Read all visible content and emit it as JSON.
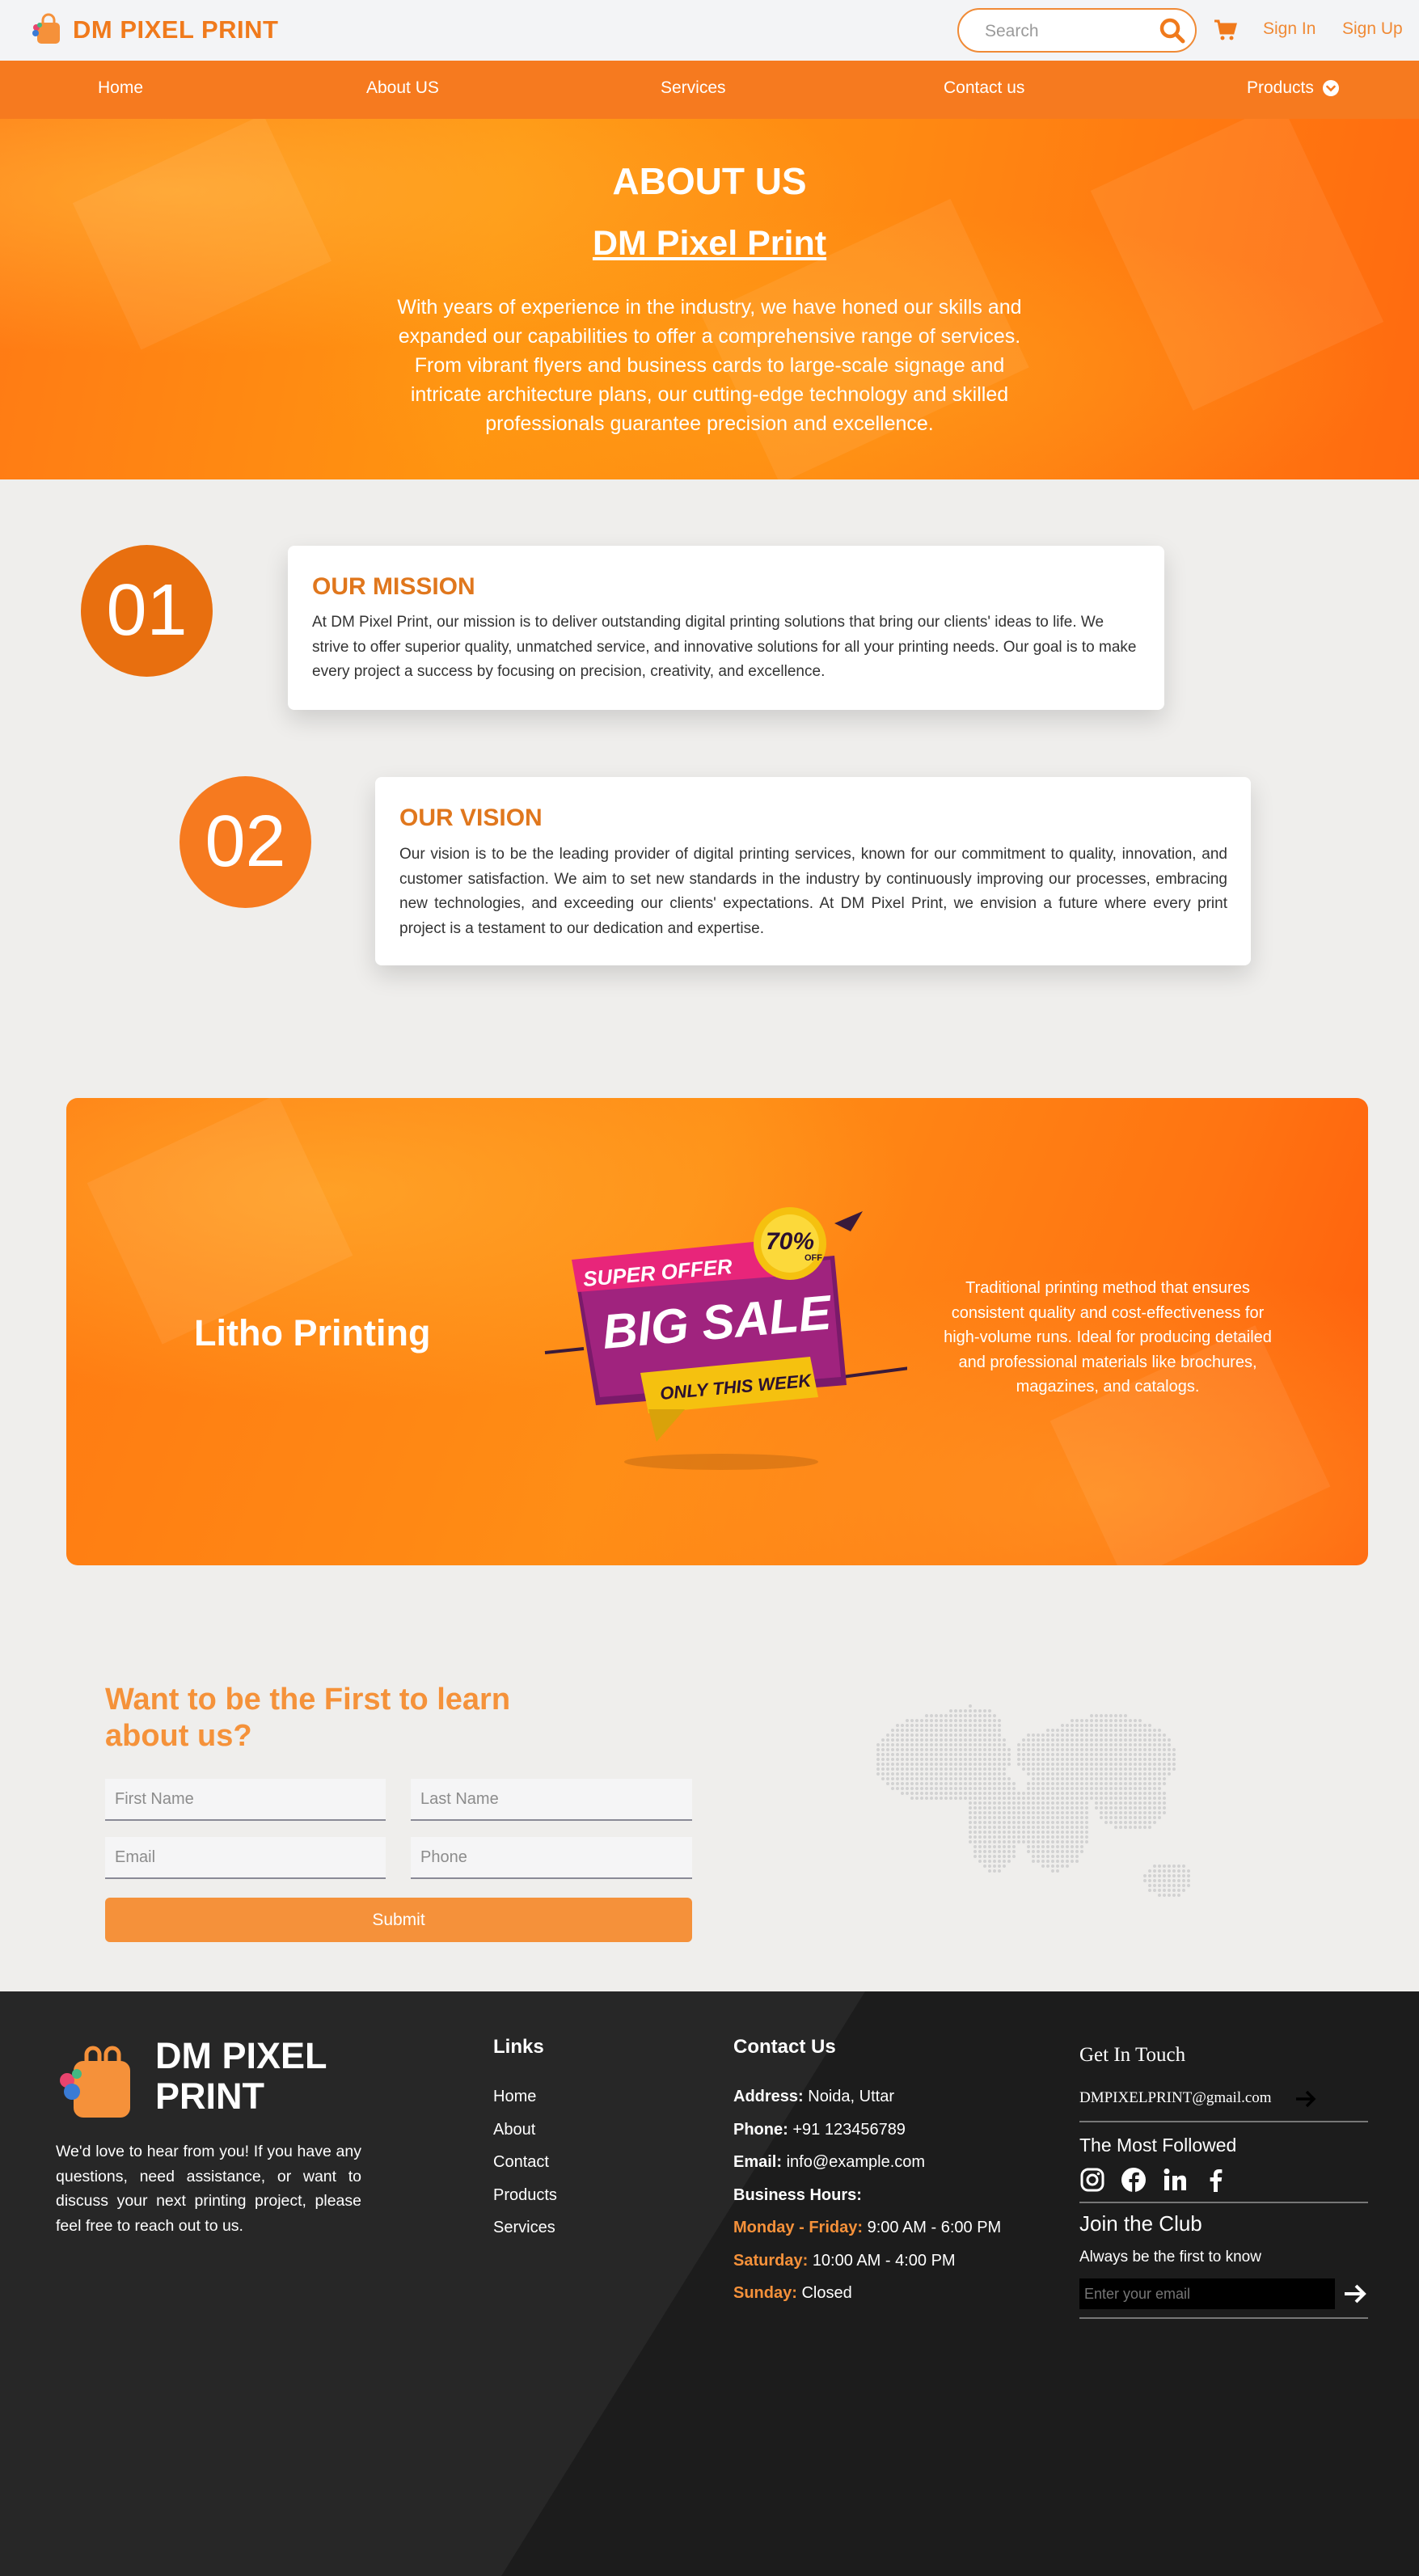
{
  "header": {
    "brand": "DM PIXEL PRINT",
    "search_placeholder": "Search",
    "sign_in": "Sign In",
    "sign_up": "Sign Up",
    "accent_color": "#f07a1c"
  },
  "nav": {
    "items": [
      "Home",
      "About US",
      "Services",
      "Contact us",
      "Products"
    ]
  },
  "hero": {
    "title": "ABOUT US",
    "subtitle": "DM Pixel Print",
    "text": "With years of experience in the industry, we have honed our skills and expanded our capabilities to offer a comprehensive range of services. From vibrant flyers and business cards to large-scale signage and intricate architecture plans, our cutting-edge technology and skilled professionals guarantee precision and excellence."
  },
  "mission": {
    "number": "01",
    "title": "OUR MISSION",
    "text": "At DM Pixel Print, our mission is to deliver outstanding digital printing solutions that bring our clients' ideas to life. We strive to offer superior quality, unmatched service, and innovative solutions for all your printing needs. Our goal is to make every project a success by focusing on precision, creativity, and excellence."
  },
  "vision": {
    "number": "02",
    "title": "OUR VISION",
    "text": "Our vision is to be the leading provider of digital printing services, known for our commitment to quality, innovation, and customer satisfaction. We aim to set new standards in the industry by continuously improving our processes, embracing new technologies, and exceeding our clients' expectations. At DM Pixel Print, we envision a future where every print project is a testament to our dedication and expertise."
  },
  "litho": {
    "title": "Litho Printing",
    "badge_super": "SUPER OFFER",
    "badge_percent": "70%",
    "badge_off": "OFF",
    "badge_big": "BIG SALE",
    "badge_week": "ONLY THIS WEEK",
    "text": "Traditional printing method that ensures consistent quality and cost-effectiveness for high-volume runs. Ideal for producing detailed and professional materials like brochures, magazines, and catalogs."
  },
  "signup": {
    "title": "Want to be the First to learn about us?",
    "first_name": "First Name",
    "last_name": "Last Name",
    "email": "Email",
    "phone": "Phone",
    "submit": "Submit"
  },
  "footer": {
    "brand_line1": "DM PIXEL",
    "brand_line2": "PRINT",
    "about": "We'd love to hear from you! If you have any questions, need assistance, or want to discuss your next printing project, please feel free to reach out to us.",
    "links_title": "Links",
    "links": [
      "Home",
      "About",
      "Contact",
      "Products",
      "Services"
    ],
    "contact_title": "Contact Us",
    "address_label": "Address:",
    "address": "Noida, Uttar",
    "phone_label": "Phone:",
    "phone": "+91 123456789",
    "email_label": "Email:",
    "email": "info@example.com",
    "hours_label": "Business Hours:",
    "weekday_label": "Monday - Friday:",
    "weekday_hours": "9:00 AM - 6:00 PM",
    "saturday_label": "Saturday:",
    "saturday_hours": "10:00 AM - 4:00 PM",
    "sunday_label": "Sunday:",
    "sunday_hours": "Closed",
    "get_in_touch": "Get In Touch",
    "touch_email": "DMPIXELPRINT@gmail.com",
    "most_followed": "The Most Followed",
    "join_club": "Join the Club",
    "join_sub": "Always be the first to know",
    "newsletter_placeholder": "Enter your email"
  }
}
